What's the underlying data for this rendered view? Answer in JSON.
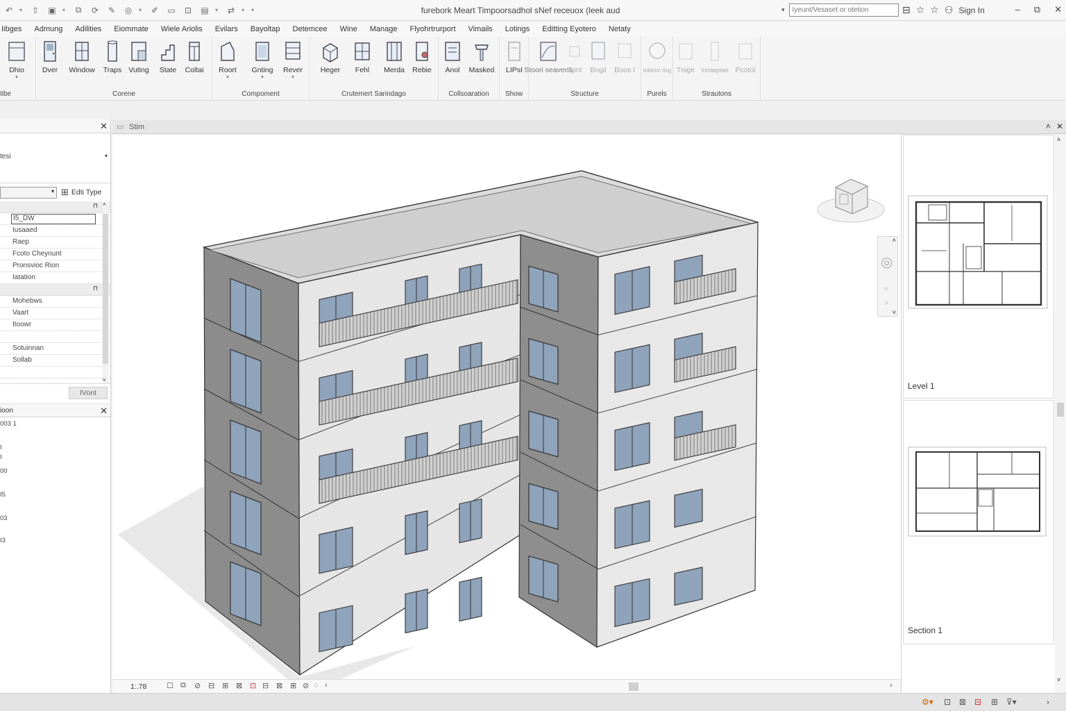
{
  "title": "furebork Meart  Timpoorsadhol sNef receuox (leek aud",
  "search": {
    "placeholder": "Iyeunt/Vesaset or otetion"
  },
  "account": {
    "signin_label": "Sign In"
  },
  "tabs": [
    "Iibges",
    "Admung",
    "Adilities",
    "Eiommate",
    "Wiele  Ariolis",
    "Evilars",
    "Bayoltap",
    "Detemcee",
    "Wine",
    "Manage",
    "Flyohrtrurport",
    "Vimails",
    "Lotings",
    "Editting  Eyotero",
    "Netaty"
  ],
  "ribbon": {
    "groups": [
      {
        "label": "Iibe",
        "buttons": [
          {
            "label": "Dhio"
          }
        ]
      },
      {
        "label": "Corene",
        "buttons": [
          {
            "label": "Dver"
          },
          {
            "label": "Window"
          },
          {
            "label": "Traps"
          },
          {
            "label": "Vuting"
          },
          {
            "label": "State"
          },
          {
            "label": "Coltai"
          }
        ]
      },
      {
        "label": "Compoment",
        "buttons": [
          {
            "label": "Roort"
          },
          {
            "label": "Gnting"
          },
          {
            "label": "Rever"
          }
        ]
      },
      {
        "label": "Crutemert Sarindago",
        "buttons": [
          {
            "label": "Heger"
          },
          {
            "label": "Fehl"
          },
          {
            "label": "Merda"
          },
          {
            "label": "Rebie"
          }
        ]
      },
      {
        "label": "Collsoaration",
        "buttons": [
          {
            "label": "Anol"
          },
          {
            "label": "Masked"
          }
        ]
      },
      {
        "label": "Show",
        "buttons": [
          {
            "label": "LIPsI"
          }
        ]
      },
      {
        "label": "Structure",
        "buttons": [
          {
            "label": "Stoori seavens"
          },
          {
            "label": "Tpnt"
          },
          {
            "label": "Bogil"
          },
          {
            "label": "Boos I"
          }
        ]
      },
      {
        "label": "Purels",
        "buttons": [
          {
            "label": "Intlinim ting"
          }
        ]
      },
      {
        "label": "Strautons",
        "buttons": [
          {
            "label": "Tnige"
          },
          {
            "label": "Inrlaepiae"
          },
          {
            "label": "Pcotol"
          }
        ]
      }
    ]
  },
  "properties": {
    "type_name": "tesi",
    "edit_type_label": "Edti Type",
    "rows": [
      {
        "kind": "cat",
        "value": ""
      },
      {
        "kind": "edit",
        "value": "I5_DW"
      },
      {
        "kind": "row",
        "value": "Iusaaed"
      },
      {
        "kind": "row",
        "value": "Raep"
      },
      {
        "kind": "row",
        "value": "Fcoto Cheynunt"
      },
      {
        "kind": "row",
        "value": "Pronsvioc Rion"
      },
      {
        "kind": "row",
        "value": "Iatation"
      },
      {
        "kind": "cat",
        "value": ""
      },
      {
        "kind": "row",
        "value": "Mohebws"
      },
      {
        "kind": "row",
        "value": "Vaart"
      },
      {
        "kind": "row",
        "value": "Itoowr"
      },
      {
        "kind": "row",
        "value": ""
      },
      {
        "kind": "row",
        "value": "Sotuinnan"
      },
      {
        "kind": "row",
        "value": "Sollab"
      },
      {
        "kind": "row",
        "value": ""
      }
    ],
    "apply_label": "IVont"
  },
  "project_browser": {
    "title": "ioon",
    "items": [
      "003 1",
      "I",
      "I",
      "00",
      "I5",
      "03",
      "I3"
    ]
  },
  "view": {
    "tab_title": "Stim",
    "scale": "1:.78"
  },
  "thumbnails": [
    {
      "label": "Level 1"
    },
    {
      "label": "Section 1"
    }
  ]
}
